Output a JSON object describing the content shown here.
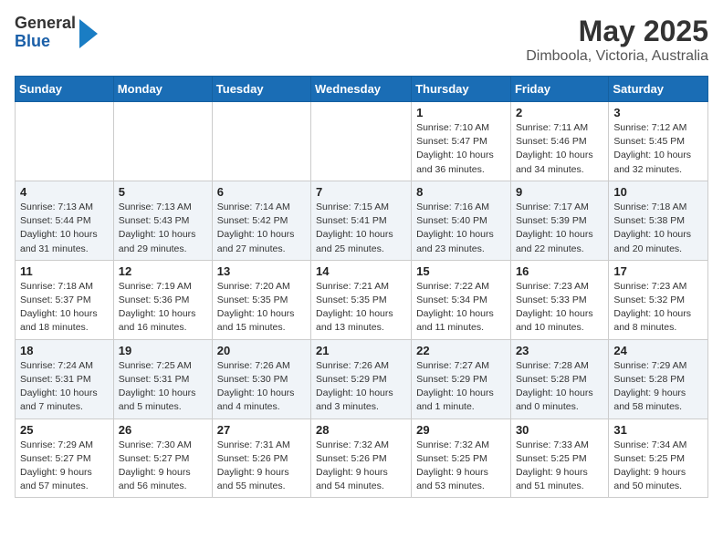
{
  "header": {
    "logo_line1": "General",
    "logo_line2": "Blue",
    "title": "May 2025",
    "subtitle": "Dimboola, Victoria, Australia"
  },
  "days_of_week": [
    "Sunday",
    "Monday",
    "Tuesday",
    "Wednesday",
    "Thursday",
    "Friday",
    "Saturday"
  ],
  "weeks": [
    [
      {
        "day": "",
        "content": ""
      },
      {
        "day": "",
        "content": ""
      },
      {
        "day": "",
        "content": ""
      },
      {
        "day": "",
        "content": ""
      },
      {
        "day": "1",
        "content": "Sunrise: 7:10 AM\nSunset: 5:47 PM\nDaylight: 10 hours\nand 36 minutes."
      },
      {
        "day": "2",
        "content": "Sunrise: 7:11 AM\nSunset: 5:46 PM\nDaylight: 10 hours\nand 34 minutes."
      },
      {
        "day": "3",
        "content": "Sunrise: 7:12 AM\nSunset: 5:45 PM\nDaylight: 10 hours\nand 32 minutes."
      }
    ],
    [
      {
        "day": "4",
        "content": "Sunrise: 7:13 AM\nSunset: 5:44 PM\nDaylight: 10 hours\nand 31 minutes."
      },
      {
        "day": "5",
        "content": "Sunrise: 7:13 AM\nSunset: 5:43 PM\nDaylight: 10 hours\nand 29 minutes."
      },
      {
        "day": "6",
        "content": "Sunrise: 7:14 AM\nSunset: 5:42 PM\nDaylight: 10 hours\nand 27 minutes."
      },
      {
        "day": "7",
        "content": "Sunrise: 7:15 AM\nSunset: 5:41 PM\nDaylight: 10 hours\nand 25 minutes."
      },
      {
        "day": "8",
        "content": "Sunrise: 7:16 AM\nSunset: 5:40 PM\nDaylight: 10 hours\nand 23 minutes."
      },
      {
        "day": "9",
        "content": "Sunrise: 7:17 AM\nSunset: 5:39 PM\nDaylight: 10 hours\nand 22 minutes."
      },
      {
        "day": "10",
        "content": "Sunrise: 7:18 AM\nSunset: 5:38 PM\nDaylight: 10 hours\nand 20 minutes."
      }
    ],
    [
      {
        "day": "11",
        "content": "Sunrise: 7:18 AM\nSunset: 5:37 PM\nDaylight: 10 hours\nand 18 minutes."
      },
      {
        "day": "12",
        "content": "Sunrise: 7:19 AM\nSunset: 5:36 PM\nDaylight: 10 hours\nand 16 minutes."
      },
      {
        "day": "13",
        "content": "Sunrise: 7:20 AM\nSunset: 5:35 PM\nDaylight: 10 hours\nand 15 minutes."
      },
      {
        "day": "14",
        "content": "Sunrise: 7:21 AM\nSunset: 5:35 PM\nDaylight: 10 hours\nand 13 minutes."
      },
      {
        "day": "15",
        "content": "Sunrise: 7:22 AM\nSunset: 5:34 PM\nDaylight: 10 hours\nand 11 minutes."
      },
      {
        "day": "16",
        "content": "Sunrise: 7:23 AM\nSunset: 5:33 PM\nDaylight: 10 hours\nand 10 minutes."
      },
      {
        "day": "17",
        "content": "Sunrise: 7:23 AM\nSunset: 5:32 PM\nDaylight: 10 hours\nand 8 minutes."
      }
    ],
    [
      {
        "day": "18",
        "content": "Sunrise: 7:24 AM\nSunset: 5:31 PM\nDaylight: 10 hours\nand 7 minutes."
      },
      {
        "day": "19",
        "content": "Sunrise: 7:25 AM\nSunset: 5:31 PM\nDaylight: 10 hours\nand 5 minutes."
      },
      {
        "day": "20",
        "content": "Sunrise: 7:26 AM\nSunset: 5:30 PM\nDaylight: 10 hours\nand 4 minutes."
      },
      {
        "day": "21",
        "content": "Sunrise: 7:26 AM\nSunset: 5:29 PM\nDaylight: 10 hours\nand 3 minutes."
      },
      {
        "day": "22",
        "content": "Sunrise: 7:27 AM\nSunset: 5:29 PM\nDaylight: 10 hours\nand 1 minute."
      },
      {
        "day": "23",
        "content": "Sunrise: 7:28 AM\nSunset: 5:28 PM\nDaylight: 10 hours\nand 0 minutes."
      },
      {
        "day": "24",
        "content": "Sunrise: 7:29 AM\nSunset: 5:28 PM\nDaylight: 9 hours\nand 58 minutes."
      }
    ],
    [
      {
        "day": "25",
        "content": "Sunrise: 7:29 AM\nSunset: 5:27 PM\nDaylight: 9 hours\nand 57 minutes."
      },
      {
        "day": "26",
        "content": "Sunrise: 7:30 AM\nSunset: 5:27 PM\nDaylight: 9 hours\nand 56 minutes."
      },
      {
        "day": "27",
        "content": "Sunrise: 7:31 AM\nSunset: 5:26 PM\nDaylight: 9 hours\nand 55 minutes."
      },
      {
        "day": "28",
        "content": "Sunrise: 7:32 AM\nSunset: 5:26 PM\nDaylight: 9 hours\nand 54 minutes."
      },
      {
        "day": "29",
        "content": "Sunrise: 7:32 AM\nSunset: 5:25 PM\nDaylight: 9 hours\nand 53 minutes."
      },
      {
        "day": "30",
        "content": "Sunrise: 7:33 AM\nSunset: 5:25 PM\nDaylight: 9 hours\nand 51 minutes."
      },
      {
        "day": "31",
        "content": "Sunrise: 7:34 AM\nSunset: 5:25 PM\nDaylight: 9 hours\nand 50 minutes."
      }
    ]
  ]
}
